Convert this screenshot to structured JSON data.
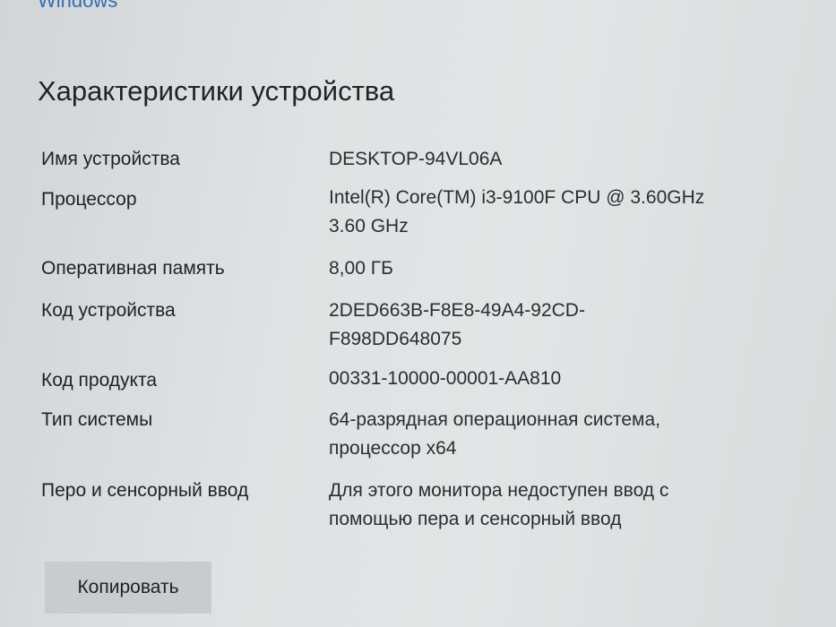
{
  "top_link": "Windows",
  "section_title": "Характеристики устройства",
  "specs": [
    {
      "label": "Имя устройства",
      "value_lines": [
        "DESKTOP-94VL06A"
      ]
    },
    {
      "label": "Процессор",
      "value_lines": [
        "Intel(R) Core(TM) i3-9100F CPU @ 3.60GHz",
        "3.60 GHz"
      ]
    },
    {
      "label": "Оперативная память",
      "value_lines": [
        "8,00 ГБ"
      ]
    },
    {
      "label": "Код устройства",
      "value_lines": [
        "2DED663B-F8E8-49A4-92CD-",
        "F898DD648075"
      ]
    },
    {
      "label": "Код продукта",
      "value_lines": [
        "00331-10000-00001-AA810"
      ]
    },
    {
      "label": "Тип системы",
      "value_lines": [
        "64-разрядная операционная система,",
        "процессор x64"
      ]
    },
    {
      "label": "Перо и сенсорный ввод",
      "value_lines": [
        "Для этого монитора недоступен ввод с",
        "помощью пера и сенсорный ввод"
      ]
    }
  ],
  "copy_button_label": "Копировать",
  "colors": {
    "link": "#2e6fb4",
    "button_bg": "#c9cbcc",
    "text": "#1f2326"
  }
}
